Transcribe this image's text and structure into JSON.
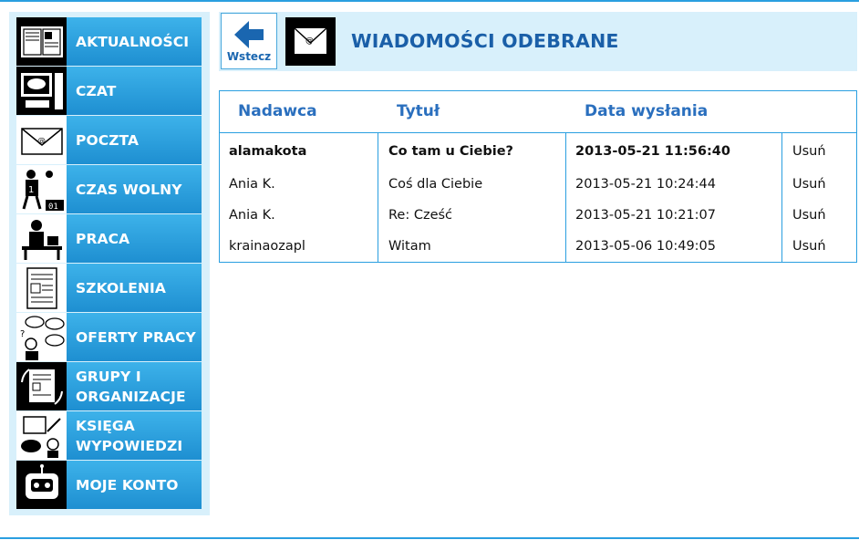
{
  "sidebar": {
    "items": [
      {
        "label": "AKTUALNOŚCI",
        "icon": "newspaper-icon"
      },
      {
        "label": "CZAT",
        "icon": "chat-computer-icon"
      },
      {
        "label": "POCZTA",
        "icon": "mail-envelope-icon"
      },
      {
        "label": "CZAS WOLNY",
        "icon": "free-time-icon"
      },
      {
        "label": "PRACA",
        "icon": "work-desk-icon"
      },
      {
        "label": "SZKOLENIA",
        "icon": "document-training-icon"
      },
      {
        "label": "OFERTY PRACY",
        "icon": "job-offers-icon"
      },
      {
        "label": "GRUPY I ORGANIZACJE",
        "icon": "groups-icon"
      },
      {
        "label": "KSIĘGA WYPOWIEDZI",
        "icon": "guestbook-icon"
      },
      {
        "label": "MOJE KONTO",
        "icon": "robot-account-icon"
      }
    ]
  },
  "header": {
    "back_label": "Wstecz",
    "title": "WIADOMOŚCI ODEBRANE"
  },
  "table": {
    "columns": [
      "Nadawca",
      "Tytuł",
      "Data wysłania"
    ],
    "rows": [
      {
        "sender": "alamakota",
        "title": "Co tam u Ciebie?",
        "date": "2013-05-21 11:56:40",
        "action": "Usuń",
        "unread": true
      },
      {
        "sender": "Ania K.",
        "title": "Coś dla Ciebie",
        "date": "2013-05-21 10:24:44",
        "action": "Usuń",
        "unread": false
      },
      {
        "sender": "Ania K.",
        "title": "Re: Cześć",
        "date": "2013-05-21 10:21:07",
        "action": "Usuń",
        "unread": false
      },
      {
        "sender": "krainaozapl",
        "title": "Witam",
        "date": "2013-05-06 10:49:05",
        "action": "Usuń",
        "unread": false
      }
    ]
  },
  "colors": {
    "accent": "#2a9fe0",
    "title": "#1a5fa8",
    "panel": "#d8f0fb"
  }
}
